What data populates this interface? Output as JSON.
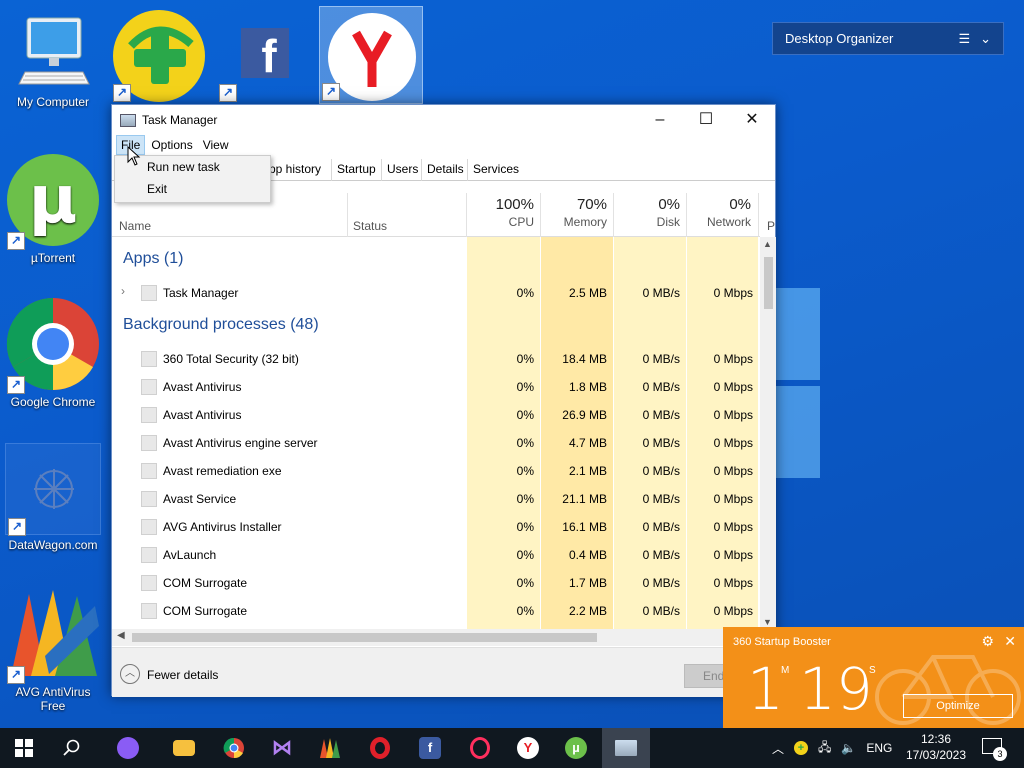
{
  "desktop": {
    "icons": [
      {
        "label": "My Computer"
      },
      {
        "label": "µTorrent"
      },
      {
        "label": "Google Chrome"
      },
      {
        "label": "DataWagon.com"
      },
      {
        "label": "AVG AntiVirus Free"
      }
    ],
    "organizer_title": "Desktop Organizer"
  },
  "task_manager": {
    "title": "Task Manager",
    "menu": [
      "File",
      "Options",
      "View"
    ],
    "file_menu": [
      "Run new task",
      "Exit"
    ],
    "tabs": [
      "pp history",
      "Startup",
      "Users",
      "Details",
      "Services"
    ],
    "columns": {
      "name": "Name",
      "status": "Status",
      "cpu": {
        "pct": "100%",
        "label": "CPU"
      },
      "memory": {
        "pct": "70%",
        "label": "Memory"
      },
      "disk": {
        "pct": "0%",
        "label": "Disk"
      },
      "network": {
        "pct": "0%",
        "label": "Network"
      },
      "power": "P"
    },
    "apps_header": "Apps (1)",
    "apps": [
      {
        "name": "Task Manager",
        "cpu": "0%",
        "mem": "2.5 MB",
        "disk": "0 MB/s",
        "net": "0 Mbps"
      }
    ],
    "bg_header": "Background processes (48)",
    "background": [
      {
        "name": "360 Total Security (32 bit)",
        "cpu": "0%",
        "mem": "18.4 MB",
        "disk": "0 MB/s",
        "net": "0 Mbps"
      },
      {
        "name": "Avast Antivirus",
        "cpu": "0%",
        "mem": "1.8 MB",
        "disk": "0 MB/s",
        "net": "0 Mbps"
      },
      {
        "name": "Avast Antivirus",
        "cpu": "0%",
        "mem": "26.9 MB",
        "disk": "0 MB/s",
        "net": "0 Mbps"
      },
      {
        "name": "Avast Antivirus engine server",
        "cpu": "0%",
        "mem": "4.7 MB",
        "disk": "0 MB/s",
        "net": "0 Mbps"
      },
      {
        "name": "Avast remediation exe",
        "cpu": "0%",
        "mem": "2.1 MB",
        "disk": "0 MB/s",
        "net": "0 Mbps"
      },
      {
        "name": "Avast Service",
        "cpu": "0%",
        "mem": "21.1 MB",
        "disk": "0 MB/s",
        "net": "0 Mbps"
      },
      {
        "name": "AVG Antivirus Installer",
        "cpu": "0%",
        "mem": "16.1 MB",
        "disk": "0 MB/s",
        "net": "0 Mbps"
      },
      {
        "name": "AvLaunch",
        "cpu": "0%",
        "mem": "0.4 MB",
        "disk": "0 MB/s",
        "net": "0 Mbps"
      },
      {
        "name": "COM Surrogate",
        "cpu": "0%",
        "mem": "1.7 MB",
        "disk": "0 MB/s",
        "net": "0 Mbps"
      },
      {
        "name": "COM Surrogate",
        "cpu": "0%",
        "mem": "2.2 MB",
        "disk": "0 MB/s",
        "net": "0 Mbps"
      }
    ],
    "fewer_details": "Fewer details",
    "end_task": "End"
  },
  "booster": {
    "title": "360 Startup Booster",
    "minutes": "1",
    "min_unit": "M",
    "seconds": "19",
    "sec_unit": "S",
    "optimize": "Optimize"
  },
  "taskbar": {
    "lang": "ENG",
    "time": "12:36",
    "date": "17/03/2023",
    "notifications": "3"
  },
  "colors": {
    "desktop_bg": "#0a5ccc",
    "cpu_col_bg": "#fff4c4",
    "mem_col_bg": "#ffe9a6",
    "booster_bg": "#f39018",
    "taskbar_bg": "#101820"
  }
}
